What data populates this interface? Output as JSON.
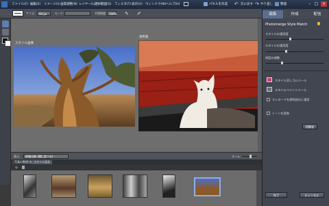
{
  "colors": {
    "accent_tab": "#5a6f90",
    "menubar": "#263449",
    "panel": "#414650",
    "canvas": "#6e6e6e"
  },
  "menu": {
    "items": [
      "ファイル(F)",
      "編集(E)",
      "イメージ(I)",
      "画質調整(N)",
      "レイヤー(L)",
      "選択範囲(S)",
      "フィルタ(T)",
      "表示(V)",
      "ウィンドウ(W)",
      "ヘルプ(H)"
    ],
    "right_items": [
      "パネルを作成",
      "元に戻す",
      "やり直し",
      "整理"
    ]
  },
  "options": {
    "size_label": "サイズ:",
    "size_value": "60 px",
    "mode_label": "モード:",
    "opacity_label": "不透明度:",
    "opacity_value": "100%"
  },
  "canvas": {
    "left_image_label": "スタイル画像",
    "right_image_label": "適用後"
  },
  "status": {
    "display_label": "表示:",
    "display_value": "前後比較 (横に並べる)",
    "zoom_label": "ズーム:"
  },
  "bin": {
    "tabs": [
      "写真の整理/追加",
      "スタイル見本"
    ]
  },
  "panel": {
    "tabs": [
      "編集",
      "作成",
      "配信"
    ],
    "title": "Photomerge Style Match",
    "sliders": [
      "スタイルの適用度",
      "スタイルの適用度",
      "明度の調整"
    ],
    "tool_erase": "スタイル消しゴムツール",
    "tool_paint": "スタイルペイントツール",
    "checkbox_stroke": "ストロークを透明部分に適用",
    "checkbox_tone": "トーンを変換",
    "reset_button": "初期化",
    "done_button": "完了",
    "cancel_button": "キャンセル"
  }
}
